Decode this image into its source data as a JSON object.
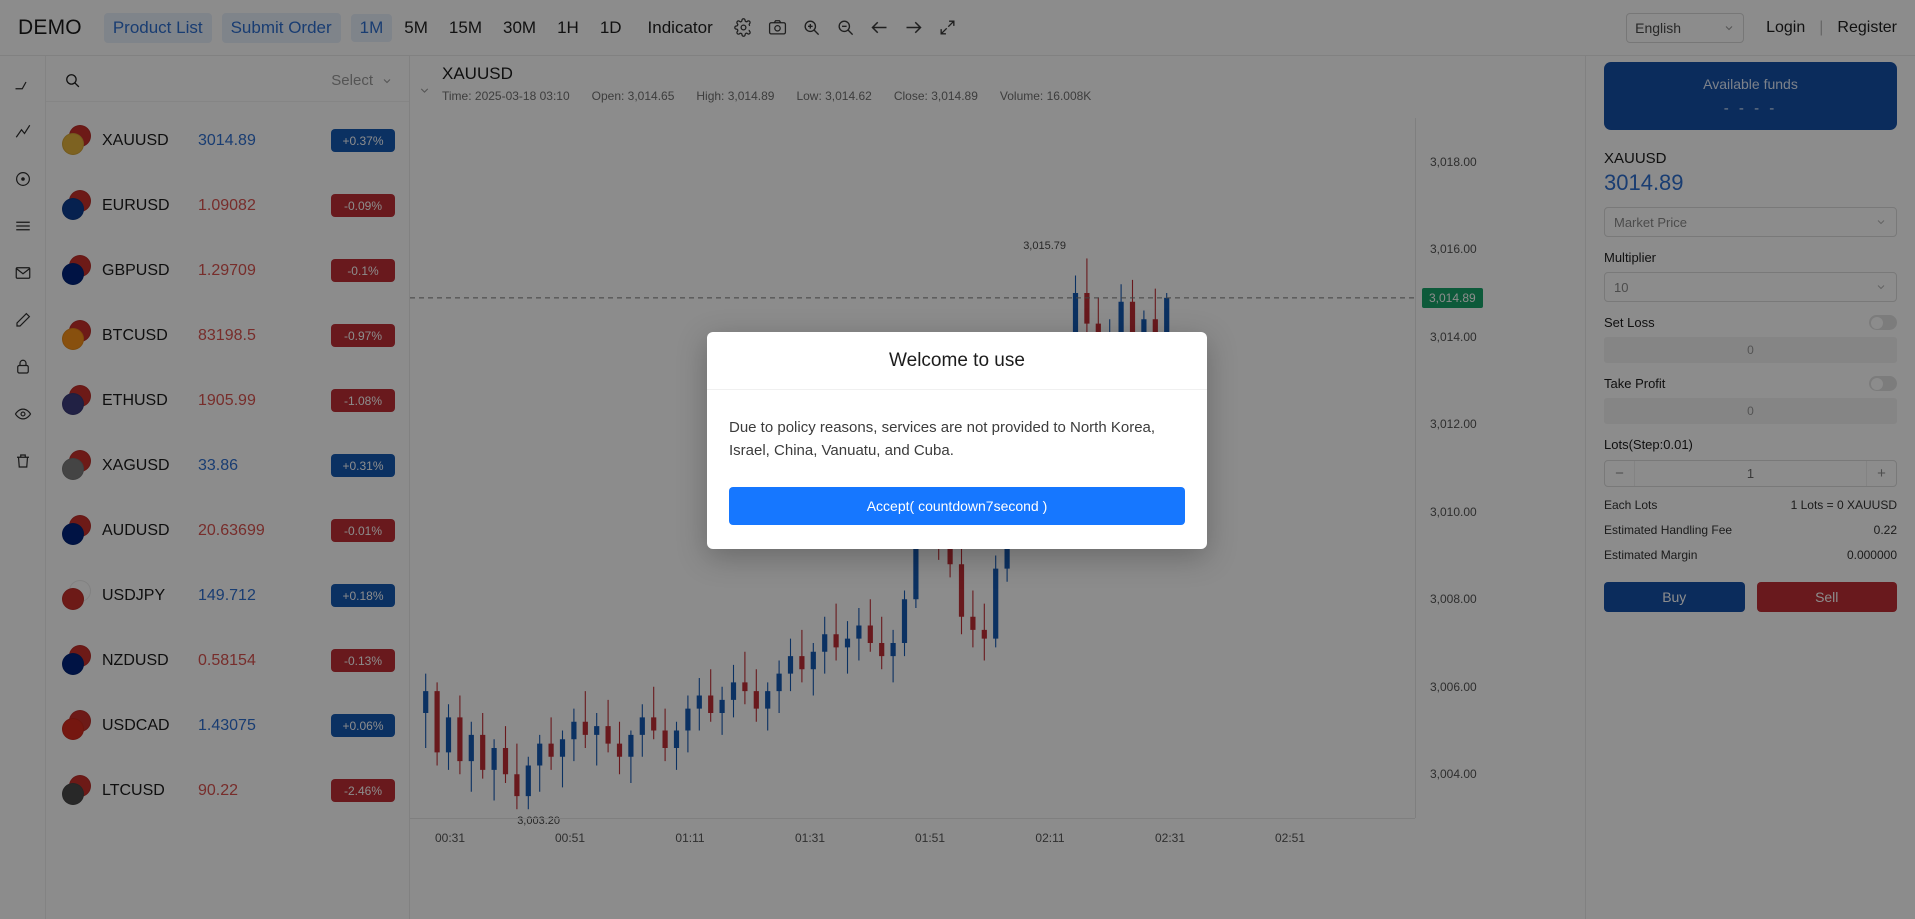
{
  "topbar": {
    "brand": "DEMO",
    "nav": [
      {
        "label": "Product List",
        "name": "product-list"
      },
      {
        "label": "Submit Order",
        "name": "submit-order"
      }
    ],
    "timeframes": [
      {
        "label": "1M",
        "active": true
      },
      {
        "label": "5M",
        "active": false
      },
      {
        "label": "15M",
        "active": false
      },
      {
        "label": "30M",
        "active": false
      },
      {
        "label": "1H",
        "active": false
      },
      {
        "label": "1D",
        "active": false
      }
    ],
    "indicator_label": "Indicator",
    "icons": [
      "gear-icon",
      "camera-icon",
      "zoom-in-icon",
      "zoom-out-icon",
      "arrow-left-icon",
      "arrow-right-icon",
      "fullscreen-icon"
    ],
    "language": "English",
    "login_label": "Login",
    "separator": "|",
    "register_label": "Register"
  },
  "toolrail": {
    "items": [
      "crosshair-icon",
      "trendline-icon",
      "circle-icon",
      "horizontal-lines-icon",
      "envelope-icon",
      "pen-icon",
      "lock-icon",
      "eye-icon",
      "trash-icon"
    ]
  },
  "symbolpanel": {
    "search_placeholder": "",
    "select_label": "Select",
    "rows": [
      {
        "symbol": "XAUUSD",
        "price": "3014.89",
        "change": "+0.37%",
        "dir": "up",
        "f1": "#c7302b",
        "f2": "#e3b23c"
      },
      {
        "symbol": "EURUSD",
        "price": "1.09082",
        "change": "-0.09%",
        "dir": "down",
        "f1": "#c7302b",
        "f2": "#0b3d91"
      },
      {
        "symbol": "GBPUSD",
        "price": "1.29709",
        "change": "-0.1%",
        "dir": "down",
        "f1": "#c7302b",
        "f2": "#00247d"
      },
      {
        "symbol": "BTCUSD",
        "price": "83198.5",
        "change": "-0.97%",
        "dir": "down",
        "f1": "#c7302b",
        "f2": "#f7931a"
      },
      {
        "symbol": "ETHUSD",
        "price": "1905.99",
        "change": "-1.08%",
        "dir": "down",
        "f1": "#c7302b",
        "f2": "#3c3c7d"
      },
      {
        "symbol": "XAGUSD",
        "price": "33.86",
        "change": "+0.31%",
        "dir": "up",
        "f1": "#c7302b",
        "f2": "#7d7d7d"
      },
      {
        "symbol": "AUDUSD",
        "price": "20.63699",
        "change": "-0.01%",
        "dir": "down",
        "f1": "#c7302b",
        "f2": "#00247d"
      },
      {
        "symbol": "USDJPY",
        "price": "149.712",
        "change": "+0.18%",
        "dir": "up",
        "f1": "#ffffff",
        "f2": "#c7302b"
      },
      {
        "symbol": "NZDUSD",
        "price": "0.58154",
        "change": "-0.13%",
        "dir": "down",
        "f1": "#c7302b",
        "f2": "#00247d"
      },
      {
        "symbol": "USDCAD",
        "price": "1.43075",
        "change": "+0.06%",
        "dir": "up",
        "f1": "#c7302b",
        "f2": "#d52b1e"
      },
      {
        "symbol": "LTCUSD",
        "price": "90.22",
        "change": "-2.46%",
        "dir": "down",
        "f1": "#c7302b",
        "f2": "#4a4a4a"
      }
    ]
  },
  "chart": {
    "symbol": "XAUUSD",
    "ohlc": {
      "time": "Time: 2025-03-18 03:10",
      "open": "Open: 3,014.65",
      "high": "High: 3,014.89",
      "low": "Low: 3,014.62",
      "close": "Close: 3,014.89",
      "volume": "Volume: 16.008K"
    },
    "current_price_tag": "3,014.89",
    "high_annotation": "3,015.79",
    "low_annotation": "3,003.20"
  },
  "chart_data": {
    "type": "candlestick",
    "title": "XAUUSD",
    "xlabel": "",
    "ylabel": "",
    "ylim": [
      3003.0,
      3019.0
    ],
    "y_ticks": [
      "3,018.00",
      "3,016.00",
      "3,014.00",
      "3,012.00",
      "3,010.00",
      "3,008.00",
      "3,006.00",
      "3,004.00"
    ],
    "y_tick_values": [
      3018,
      3016,
      3014,
      3012,
      3010,
      3008,
      3006,
      3004
    ],
    "x_ticks": [
      "00:31",
      "00:51",
      "01:11",
      "01:31",
      "01:51",
      "02:11",
      "02:31",
      "02:51"
    ],
    "grid": false,
    "up_color": "#1559b3",
    "down_color": "#bf2f35",
    "current_price": 3014.89,
    "high_point": 3015.79,
    "low_point": 3003.2,
    "candles": [
      {
        "o": 3005.4,
        "h": 3006.3,
        "l": 3004.6,
        "c": 3005.9
      },
      {
        "o": 3005.9,
        "h": 3006.1,
        "l": 3004.2,
        "c": 3004.5
      },
      {
        "o": 3004.5,
        "h": 3005.6,
        "l": 3004.1,
        "c": 3005.3
      },
      {
        "o": 3005.3,
        "h": 3005.8,
        "l": 3004.0,
        "c": 3004.3
      },
      {
        "o": 3004.3,
        "h": 3005.2,
        "l": 3003.6,
        "c": 3004.9
      },
      {
        "o": 3004.9,
        "h": 3005.4,
        "l": 3003.9,
        "c": 3004.1
      },
      {
        "o": 3004.1,
        "h": 3004.8,
        "l": 3003.4,
        "c": 3004.6
      },
      {
        "o": 3004.6,
        "h": 3005.1,
        "l": 3003.8,
        "c": 3004.0
      },
      {
        "o": 3004.0,
        "h": 3004.7,
        "l": 3003.2,
        "c": 3003.5
      },
      {
        "o": 3003.5,
        "h": 3004.4,
        "l": 3003.2,
        "c": 3004.2
      },
      {
        "o": 3004.2,
        "h": 3004.9,
        "l": 3003.6,
        "c": 3004.7
      },
      {
        "o": 3004.7,
        "h": 3005.3,
        "l": 3004.1,
        "c": 3004.4
      },
      {
        "o": 3004.4,
        "h": 3005.0,
        "l": 3003.7,
        "c": 3004.8
      },
      {
        "o": 3004.8,
        "h": 3005.5,
        "l": 3004.3,
        "c": 3005.2
      },
      {
        "o": 3005.2,
        "h": 3005.9,
        "l": 3004.6,
        "c": 3004.9
      },
      {
        "o": 3004.9,
        "h": 3005.4,
        "l": 3004.2,
        "c": 3005.1
      },
      {
        "o": 3005.1,
        "h": 3005.7,
        "l": 3004.5,
        "c": 3004.7
      },
      {
        "o": 3004.7,
        "h": 3005.2,
        "l": 3004.0,
        "c": 3004.4
      },
      {
        "o": 3004.4,
        "h": 3005.0,
        "l": 3003.8,
        "c": 3004.9
      },
      {
        "o": 3004.9,
        "h": 3005.6,
        "l": 3004.4,
        "c": 3005.3
      },
      {
        "o": 3005.3,
        "h": 3006.0,
        "l": 3004.8,
        "c": 3005.0
      },
      {
        "o": 3005.0,
        "h": 3005.5,
        "l": 3004.3,
        "c": 3004.6
      },
      {
        "o": 3004.6,
        "h": 3005.2,
        "l": 3004.1,
        "c": 3005.0
      },
      {
        "o": 3005.0,
        "h": 3005.8,
        "l": 3004.5,
        "c": 3005.5
      },
      {
        "o": 3005.5,
        "h": 3006.2,
        "l": 3005.0,
        "c": 3005.8
      },
      {
        "o": 3005.8,
        "h": 3006.4,
        "l": 3005.2,
        "c": 3005.4
      },
      {
        "o": 3005.4,
        "h": 3006.0,
        "l": 3004.9,
        "c": 3005.7
      },
      {
        "o": 3005.7,
        "h": 3006.5,
        "l": 3005.3,
        "c": 3006.1
      },
      {
        "o": 3006.1,
        "h": 3006.8,
        "l": 3005.6,
        "c": 3005.9
      },
      {
        "o": 3005.9,
        "h": 3006.4,
        "l": 3005.2,
        "c": 3005.5
      },
      {
        "o": 3005.5,
        "h": 3006.1,
        "l": 3005.0,
        "c": 3005.9
      },
      {
        "o": 3005.9,
        "h": 3006.6,
        "l": 3005.4,
        "c": 3006.3
      },
      {
        "o": 3006.3,
        "h": 3007.1,
        "l": 3005.9,
        "c": 3006.7
      },
      {
        "o": 3006.7,
        "h": 3007.3,
        "l": 3006.1,
        "c": 3006.4
      },
      {
        "o": 3006.4,
        "h": 3007.0,
        "l": 3005.8,
        "c": 3006.8
      },
      {
        "o": 3006.8,
        "h": 3007.6,
        "l": 3006.3,
        "c": 3007.2
      },
      {
        "o": 3007.2,
        "h": 3007.9,
        "l": 3006.6,
        "c": 3006.9
      },
      {
        "o": 3006.9,
        "h": 3007.5,
        "l": 3006.3,
        "c": 3007.1
      },
      {
        "o": 3007.1,
        "h": 3007.8,
        "l": 3006.6,
        "c": 3007.4
      },
      {
        "o": 3007.4,
        "h": 3008.0,
        "l": 3006.8,
        "c": 3007.0
      },
      {
        "o": 3007.0,
        "h": 3007.6,
        "l": 3006.4,
        "c": 3006.7
      },
      {
        "o": 3006.7,
        "h": 3007.3,
        "l": 3006.1,
        "c": 3007.0
      },
      {
        "o": 3007.0,
        "h": 3008.2,
        "l": 3006.7,
        "c": 3008.0
      },
      {
        "o": 3008.0,
        "h": 3010.5,
        "l": 3007.8,
        "c": 3010.1
      },
      {
        "o": 3010.1,
        "h": 3010.8,
        "l": 3009.2,
        "c": 3009.6
      },
      {
        "o": 3009.6,
        "h": 3010.2,
        "l": 3008.9,
        "c": 3009.3
      },
      {
        "o": 3009.3,
        "h": 3009.9,
        "l": 3008.5,
        "c": 3008.8
      },
      {
        "o": 3008.8,
        "h": 3009.4,
        "l": 3007.2,
        "c": 3007.6
      },
      {
        "o": 3007.6,
        "h": 3008.2,
        "l": 3006.9,
        "c": 3007.3
      },
      {
        "o": 3007.3,
        "h": 3007.9,
        "l": 3006.6,
        "c": 3007.1
      },
      {
        "o": 3007.1,
        "h": 3009.0,
        "l": 3006.9,
        "c": 3008.7
      },
      {
        "o": 3008.7,
        "h": 3011.4,
        "l": 3008.4,
        "c": 3011.0
      },
      {
        "o": 3011.0,
        "h": 3012.1,
        "l": 3010.4,
        "c": 3011.6
      },
      {
        "o": 3011.6,
        "h": 3012.3,
        "l": 3010.8,
        "c": 3011.2
      },
      {
        "o": 3011.2,
        "h": 3011.8,
        "l": 3010.2,
        "c": 3010.6
      },
      {
        "o": 3010.6,
        "h": 3012.6,
        "l": 3010.3,
        "c": 3012.2
      },
      {
        "o": 3012.2,
        "h": 3014.1,
        "l": 3011.9,
        "c": 3013.8
      },
      {
        "o": 3013.8,
        "h": 3015.4,
        "l": 3013.4,
        "c": 3015.0
      },
      {
        "o": 3015.0,
        "h": 3015.79,
        "l": 3013.9,
        "c": 3014.3
      },
      {
        "o": 3014.3,
        "h": 3014.9,
        "l": 3013.2,
        "c": 3013.6
      },
      {
        "o": 3013.6,
        "h": 3014.4,
        "l": 3012.8,
        "c": 3014.1
      },
      {
        "o": 3014.1,
        "h": 3015.2,
        "l": 3013.7,
        "c": 3014.8
      },
      {
        "o": 3014.8,
        "h": 3015.3,
        "l": 3013.5,
        "c": 3013.9
      },
      {
        "o": 3013.9,
        "h": 3014.6,
        "l": 3013.1,
        "c": 3014.4
      },
      {
        "o": 3014.4,
        "h": 3015.1,
        "l": 3013.8,
        "c": 3014.0
      },
      {
        "o": 3014.0,
        "h": 3015.0,
        "l": 3013.6,
        "c": 3014.89
      }
    ]
  },
  "orderpanel": {
    "fund_title": "Available funds",
    "fund_value": "- - - -",
    "symbol": "XAUUSD",
    "price": "3014.89",
    "order_type": "Market Price",
    "multiplier_label": "Multiplier",
    "multiplier_value": "10",
    "set_loss_label": "Set Loss",
    "set_loss_value": "0",
    "take_profit_label": "Take Profit",
    "take_profit_value": "0",
    "lots_label": "Lots(Step:0.01)",
    "lots_value": "1",
    "minus": "−",
    "plus": "+",
    "info": [
      {
        "label": "Each Lots",
        "value": "1 Lots = 0 XAUUSD"
      },
      {
        "label": "Estimated Handling Fee",
        "value": "0.22"
      },
      {
        "label": "Estimated Margin",
        "value": "0.000000"
      }
    ],
    "buy_label": "Buy",
    "sell_label": "Sell"
  },
  "modal": {
    "title": "Welcome to use",
    "body": "Due to policy reasons, services are not provided to North Korea, Israel, China, Vanuatu, and Cuba.",
    "accept_label": "Accept( countdown7second )"
  }
}
